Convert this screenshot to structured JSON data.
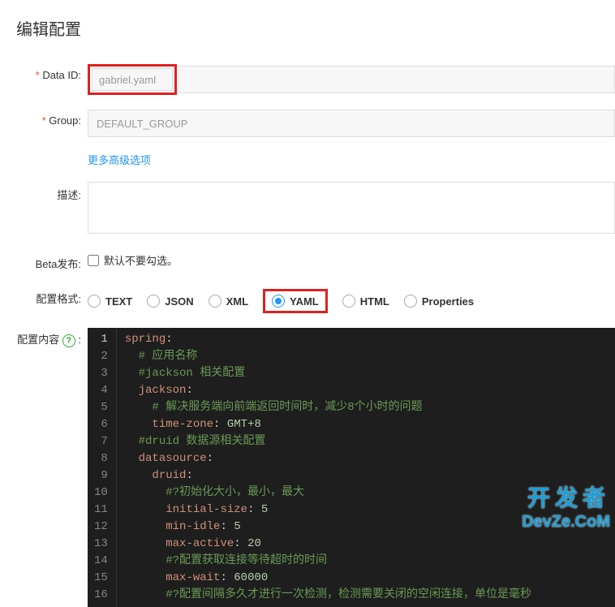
{
  "page": {
    "title": "编辑配置"
  },
  "form": {
    "dataId": {
      "label": "Data ID:",
      "value": "gabriel.yaml"
    },
    "group": {
      "label": "Group:",
      "value": "DEFAULT_GROUP"
    },
    "moreLink": "更多高级选项",
    "description": {
      "label": "描述:",
      "value": ""
    },
    "beta": {
      "label": "Beta发布:",
      "hint": "默认不要勾选。"
    },
    "format": {
      "label": "配置格式:",
      "options": [
        "TEXT",
        "JSON",
        "XML",
        "YAML",
        "HTML",
        "Properties"
      ],
      "selected": "YAML"
    },
    "content": {
      "label": "配置内容"
    }
  },
  "code": {
    "lines": [
      {
        "n": 1,
        "indent": 0,
        "type": "key",
        "key": "spring",
        "after": ":"
      },
      {
        "n": 2,
        "indent": 1,
        "type": "comment",
        "text": "# 应用名称"
      },
      {
        "n": 3,
        "indent": 1,
        "type": "comment",
        "text": "#jackson 相关配置"
      },
      {
        "n": 4,
        "indent": 1,
        "type": "key",
        "key": "jackson",
        "after": ":"
      },
      {
        "n": 5,
        "indent": 2,
        "type": "comment",
        "text": "# 解决服务端向前端返回时间时，减少8个小时的问题"
      },
      {
        "n": 6,
        "indent": 2,
        "type": "kv",
        "key": "time-zone",
        "value": "GMT+8"
      },
      {
        "n": 7,
        "indent": 1,
        "type": "comment",
        "text": "#druid 数据源相关配置"
      },
      {
        "n": 8,
        "indent": 1,
        "type": "key",
        "key": "datasource",
        "after": ":"
      },
      {
        "n": 9,
        "indent": 2,
        "type": "key",
        "key": "druid",
        "after": ":"
      },
      {
        "n": 10,
        "indent": 3,
        "type": "comment",
        "text": "#?初始化大小，最小，最大"
      },
      {
        "n": 11,
        "indent": 3,
        "type": "kv",
        "key": "initial-size",
        "value": "5"
      },
      {
        "n": 12,
        "indent": 3,
        "type": "kv",
        "key": "min-idle",
        "value": "5"
      },
      {
        "n": 13,
        "indent": 3,
        "type": "kv",
        "key": "max-active",
        "value": "20"
      },
      {
        "n": 14,
        "indent": 3,
        "type": "comment",
        "text": "#?配置获取连接等待超时的时间"
      },
      {
        "n": 15,
        "indent": 3,
        "type": "kv",
        "key": "max-wait",
        "value": "60000"
      },
      {
        "n": 16,
        "indent": 3,
        "type": "comment",
        "text": "#?配置间隔多久才进行一次检测，检测需要关闭的空闲连接，单位是毫秒"
      }
    ]
  },
  "watermark": {
    "line1": "开发者",
    "line2": "DevZe.CoM"
  }
}
